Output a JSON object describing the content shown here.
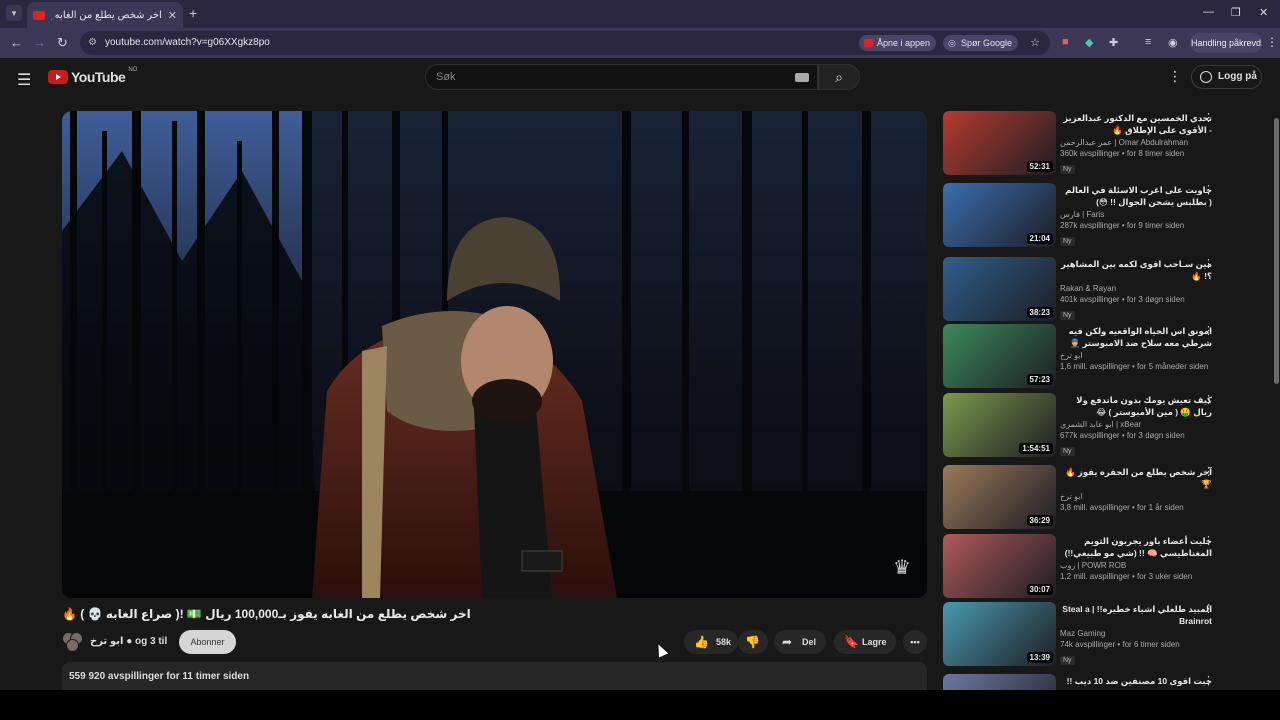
{
  "browser": {
    "tab_title": "اخر شخص يطلع من الغابه يفوز ب...",
    "tab_close": "✕",
    "new_tab": "+",
    "url": "youtube.com/watch?v=g06XXgkz8po",
    "open_in_app": "Åpne i appen",
    "ask_google": "Spør Google",
    "action_required": "Handling påkrevd",
    "window_controls": [
      "—",
      "❐",
      "✕"
    ]
  },
  "youtube": {
    "logo_text": "YouTube",
    "country_code": "NO",
    "search_placeholder": "Søk",
    "login_label": "Logg på"
  },
  "video": {
    "title": "اخر شخص يطلع من الغابه يفوز بـ100,000 ريال 💵 !( صراع الغابه 💀 ) 🔥",
    "channel_line": "ابو ترخ ● og 3 til",
    "subscribe_label": "Abonner",
    "likes": "58k",
    "share_label": "Del",
    "save_label": "Lagre",
    "more_label": "•••",
    "views_line": "559 920 avspillinger  for 11 timer siden"
  },
  "recommendations": [
    {
      "title": "تحدي الخمسين مع الدكتور عبدالعزيز - الأقوى على الإطلاق 🔥",
      "channel": "عمر عبدالرحمن | Omar Abdulrahman",
      "views": "360k avspillinger • for 8 timer siden",
      "duration": "52:31",
      "badge": "Ny",
      "thumb_color": "#b73b2f"
    },
    {
      "title": "جاوبت على اغرب الاسئلة في العالم ( بطلبس يشحن الجوال !! 😳)",
      "channel": "فارس | Faris",
      "views": "287k avspillinger • for 9 timer siden",
      "duration": "21:04",
      "badge": "Ny",
      "thumb_color": "#3a6fb0"
    },
    {
      "title": "مين سـاحب اقوى لكمه بين المشاهير ؟! 🔥",
      "channel": "Rakan & Rayan",
      "views": "401k avspillinger • for 3 døgn siden",
      "duration": "38:23",
      "badge": "Ny",
      "thumb_color": "#2f5f8c"
    },
    {
      "title": "امونق اس الحياه الواقعيه ولكن فيه شرطي معه سلاح ضد الامبوستر 👮 🔫 !!",
      "channel": "ابو ترخ",
      "views": "1,6 mill. avspillinger • for 5 måneder siden",
      "duration": "57:23",
      "badge": "",
      "thumb_color": "#3c8a5a"
    },
    {
      "title": "كيف تعيش يومك بدون ماتدفع ولا ريال 🤑 ( مين الأمبوستر ) 😂",
      "channel": "ابو عابد الشمري | xBear",
      "views": "677k avspillinger • for 3 døgn siden",
      "duration": "1:54:51",
      "badge": "Ny",
      "thumb_color": "#7a9a4a"
    },
    {
      "title": "آخر شخص يطلع من الحفره يفوز 🔥 🏆",
      "channel": "ابو ترخ",
      "views": "3,8 mill. avspillinger • for 1 år siden",
      "duration": "36:29",
      "badge": "",
      "thumb_color": "#9a7a5a"
    },
    {
      "title": "خليت أعضاء باور يجربون الثويم المغناطيسي 🧠 !! (شي مو طبيعي!!)",
      "channel": "روب | POWR ROB",
      "views": "1,2 mill. avspillinger • for 3 uker siden",
      "duration": "30:07",
      "badge": "",
      "thumb_color": "#b05a5a"
    },
    {
      "title": "المبيد طلعلي اشياء خطيره!! | Steal a Brainrot",
      "channel": "Maz Gaming",
      "views": "74k avspillinger • for 6 timer siden",
      "duration": "13:39",
      "badge": "Ny",
      "thumb_color": "#4a9ab0"
    },
    {
      "title": "جبت اقوى 10 مصنفين ضد 10 ديب !!",
      "channel": "",
      "views": "",
      "duration": "",
      "badge": "",
      "thumb_color": "#6a7aa0"
    }
  ]
}
